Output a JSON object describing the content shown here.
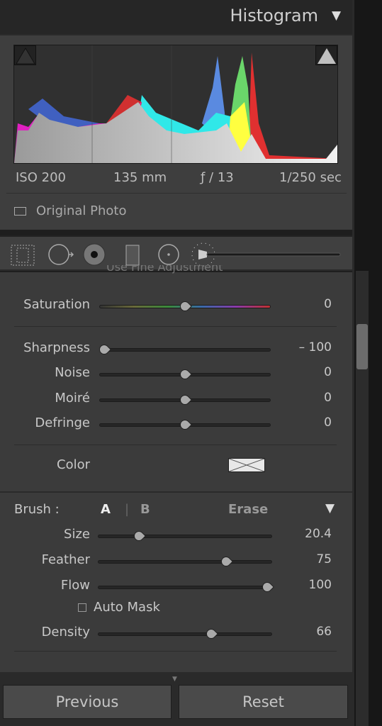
{
  "header": {
    "title": "Histogram",
    "collapse_icon": "triangle-down-icon"
  },
  "histogram": {
    "meta": {
      "iso": "ISO 200",
      "focal": "135 mm",
      "aperture": "ƒ / 13",
      "shutter": "1/250 sec"
    },
    "original_photo": "Original Photo",
    "shadow_clip": false,
    "highlight_clip": true
  },
  "tools": [
    "crop-overlay",
    "spot-removal",
    "red-eye",
    "graduated-filter",
    "radial-filter",
    "adjustment-brush"
  ],
  "fine_adjust": "Use Fine Adjustment",
  "effects": [
    {
      "label": "Saturation",
      "value": "0",
      "pos": 0.5,
      "hue": true
    },
    {
      "label": "Sharpness",
      "value": "– 100",
      "pos": 0.0
    },
    {
      "label": "Noise",
      "value": "0",
      "pos": 0.5
    },
    {
      "label": "Moiré",
      "value": "0",
      "pos": 0.5
    },
    {
      "label": "Defringe",
      "value": "0",
      "pos": 0.5
    }
  ],
  "color_label": "Color",
  "brush": {
    "label": "Brush :",
    "a": "A",
    "sep": "|",
    "b": "B",
    "erase": "Erase",
    "sliders": [
      {
        "label": "Size",
        "value": "20.4",
        "pos": 0.22
      },
      {
        "label": "Feather",
        "value": "75",
        "pos": 0.75
      },
      {
        "label": "Flow",
        "value": "100",
        "pos": 1.0
      }
    ],
    "auto_mask": "Auto Mask",
    "density": {
      "label": "Density",
      "value": "66",
      "pos": 0.66
    }
  },
  "footer": {
    "previous": "Previous",
    "reset": "Reset"
  }
}
